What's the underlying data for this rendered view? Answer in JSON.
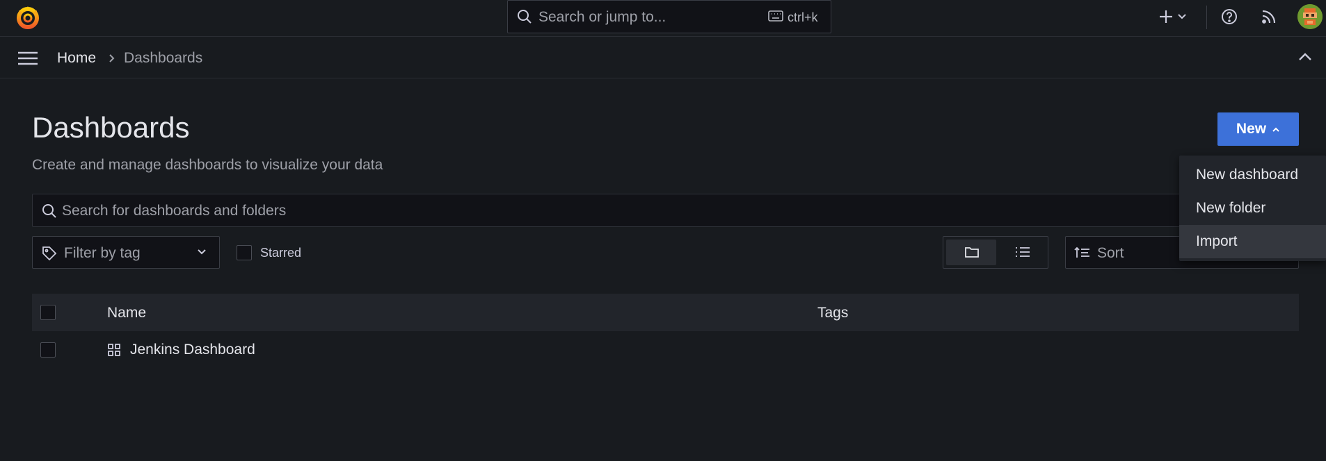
{
  "topbar": {
    "search_placeholder": "Search or jump to...",
    "search_shortcut": "ctrl+k",
    "icons": [
      "grafana-logo-icon",
      "search-icon",
      "keyboard-icon",
      "plus-icon",
      "chevron-down-icon",
      "help-icon",
      "news-rss-icon",
      "avatar"
    ]
  },
  "breadcrumb": {
    "home": "Home",
    "current": "Dashboards"
  },
  "page": {
    "title": "Dashboards",
    "subtitle": "Create and manage dashboards to visualize your data",
    "new_button": "New"
  },
  "dropdown": {
    "items": [
      "New dashboard",
      "New folder",
      "Import"
    ],
    "highlighted": "Import"
  },
  "filters": {
    "search_placeholder": "Search for dashboards and folders",
    "tag_placeholder": "Filter by tag",
    "starred_label": "Starred",
    "sort_placeholder": "Sort",
    "view_mode": "folders"
  },
  "table": {
    "columns": [
      "Name",
      "Tags"
    ],
    "rows": [
      {
        "name": "Jenkins Dashboard",
        "tags": ""
      }
    ]
  },
  "colors": {
    "background": "#181b1f",
    "primary": "#3d71d9",
    "text": "#e4e5ea",
    "muted": "#9ea0a8"
  }
}
